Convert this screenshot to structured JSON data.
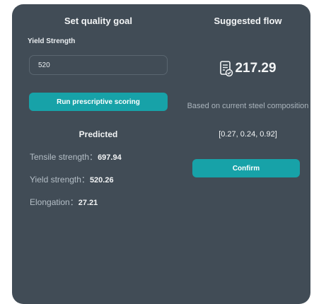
{
  "goal_panel": {
    "title": "Set quality goal",
    "field_label": "Yield Strength",
    "input_value": "520",
    "run_button_label": "Run prescriptive scoring",
    "predicted_title": "Predicted",
    "metrics": [
      {
        "label": "Tensile strength：",
        "value": "697.94"
      },
      {
        "label": "Yield strength：",
        "value": "520.26"
      },
      {
        "label": "Elongation：",
        "value": "27.21"
      }
    ]
  },
  "flow_panel": {
    "title": "Suggested flow",
    "icon": "document-check-icon",
    "value": "217.29",
    "basis_text": "Based on current steel composition",
    "composition": "[0.27, 0.24, 0.92]",
    "confirm_label": "Confirm"
  },
  "colors": {
    "panel_bg": "#414c56",
    "accent": "#17a2a8",
    "text_primary": "#f2f4f5",
    "text_muted": "#b4bec6"
  }
}
